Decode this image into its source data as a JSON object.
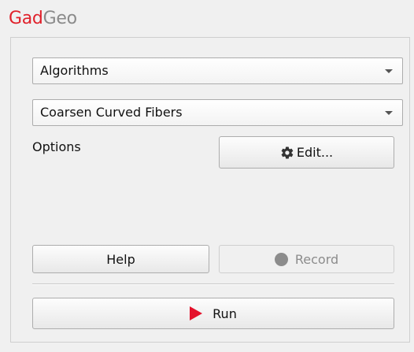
{
  "app": {
    "title_part1": "Gad",
    "title_part2": "Geo",
    "accent_color": "#e0202a"
  },
  "algorithms_combo": {
    "value": "Algorithms"
  },
  "filter_combo": {
    "value": "Coarsen Curved Fibers"
  },
  "options": {
    "label": "Options",
    "edit_label": "Edit...",
    "edit_icon": "gear-icon"
  },
  "buttons": {
    "help_label": "Help",
    "record_label": "Record",
    "record_icon": "record-dot-icon",
    "run_label": "Run",
    "run_icon": "play-icon",
    "run_icon_color": "#e4112b"
  }
}
